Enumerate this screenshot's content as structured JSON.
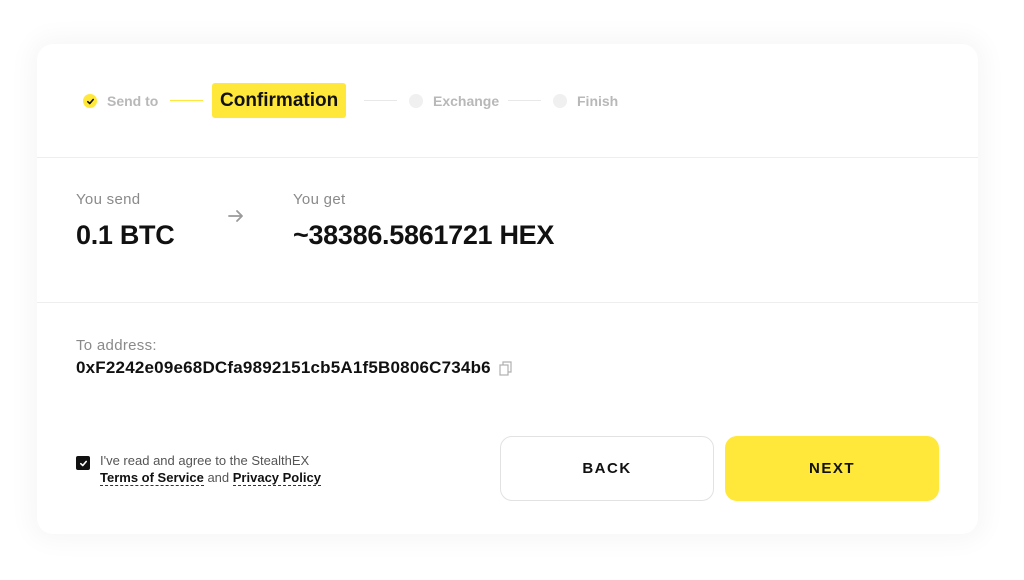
{
  "colors": {
    "accent": "#ffe83a",
    "text_primary": "#111111",
    "text_muted": "#8a8a8a",
    "step_inactive": "#b8b8b8"
  },
  "stepper": {
    "steps": [
      {
        "label": "Send to",
        "state": "done",
        "icon": "check-icon"
      },
      {
        "label": "Confirmation",
        "state": "active"
      },
      {
        "label": "Exchange",
        "state": "pending"
      },
      {
        "label": "Finish",
        "state": "pending"
      }
    ]
  },
  "exchange": {
    "send_label": "You send",
    "send_amount": "0.1 BTC",
    "arrow_icon": "arrow-right-icon",
    "get_label": "You get",
    "get_amount": "~38386.5861721 HEX"
  },
  "address": {
    "label": "To address:",
    "value": "0xF2242e09e68DCfa9892151cb5A1f5B0806C734b6",
    "copy_icon": "copy-icon"
  },
  "agreement": {
    "checked": true,
    "text_prefix": "I've read and agree to the StealthEX",
    "terms_link": "Terms of Service",
    "conjunction": "and",
    "privacy_link": "Privacy Policy"
  },
  "actions": {
    "back_label": "BACK",
    "next_label": "NEXT"
  }
}
